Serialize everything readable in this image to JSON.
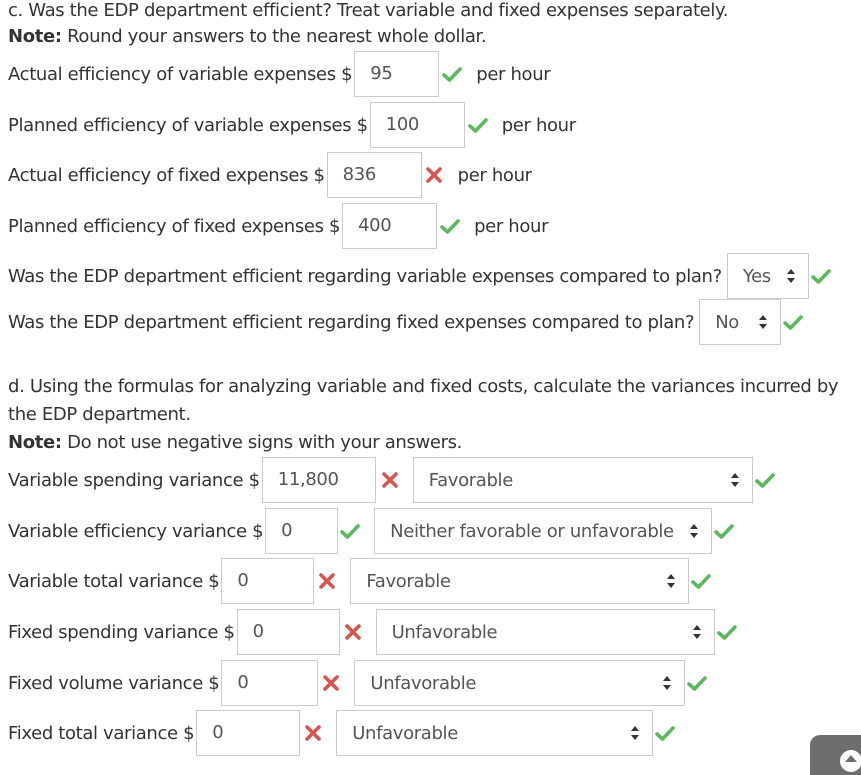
{
  "part_c": {
    "heading": "c. Was the EDP department efficient? Treat variable and fixed expenses separately.",
    "note_label": "Note:",
    "note_text": " Round your answers to the nearest whole dollar.",
    "rows": [
      {
        "label": "Actual efficiency of variable expenses $",
        "value": "95",
        "status": "correct",
        "suffix": "per hour"
      },
      {
        "label": "Planned efficiency of variable expenses $",
        "value": "100",
        "status": "correct",
        "suffix": "per hour"
      },
      {
        "label": "Actual efficiency of fixed expenses $",
        "value": "836",
        "status": "incorrect",
        "suffix": "per hour"
      },
      {
        "label": "Planned efficiency of fixed expenses $",
        "value": "400",
        "status": "correct",
        "suffix": "per hour"
      }
    ],
    "questions": [
      {
        "label": "Was the EDP department efficient regarding variable expenses compared to plan?",
        "selected": "Yes",
        "status": "correct"
      },
      {
        "label": "Was the EDP department efficient regarding fixed expenses compared to plan?",
        "selected": "No",
        "status": "correct"
      }
    ]
  },
  "part_d": {
    "heading_line1": "d. Using the formulas for analyzing variable and fixed costs, calculate the variances incurred by",
    "heading_line2": "the EDP department.",
    "note_label": "Note:",
    "note_text": " Do not use negative signs with your answers.",
    "rows": [
      {
        "label": "Variable spending variance $",
        "value": "11,800",
        "value_status": "incorrect",
        "selected": "Favorable",
        "select_status": "correct"
      },
      {
        "label": "Variable efficiency variance $",
        "value": "0",
        "value_status": "correct",
        "selected": "Neither favorable or unfavorable",
        "select_status": "correct"
      },
      {
        "label": "Variable total variance $",
        "value": "0",
        "value_status": "incorrect",
        "selected": "Favorable",
        "select_status": "correct"
      },
      {
        "label": "Fixed spending variance $",
        "value": "0",
        "value_status": "incorrect",
        "selected": "Unfavorable",
        "select_status": "correct"
      },
      {
        "label": "Fixed volume variance $",
        "value": "0",
        "value_status": "incorrect",
        "selected": "Unfavorable",
        "select_status": "correct"
      },
      {
        "label": "Fixed total variance $",
        "value": "0",
        "value_status": "incorrect",
        "selected": "Unfavorable",
        "select_status": "correct"
      }
    ]
  },
  "colors": {
    "correct": "#5cb85c",
    "incorrect": "#d9534f",
    "text": "#333333",
    "input_text": "#555555",
    "border": "#cccccc"
  },
  "icons": {
    "correct": "check-icon",
    "incorrect": "cross-icon",
    "select_arrow": "sort-updown-icon",
    "scroll_top": "chevron-up-icon"
  }
}
